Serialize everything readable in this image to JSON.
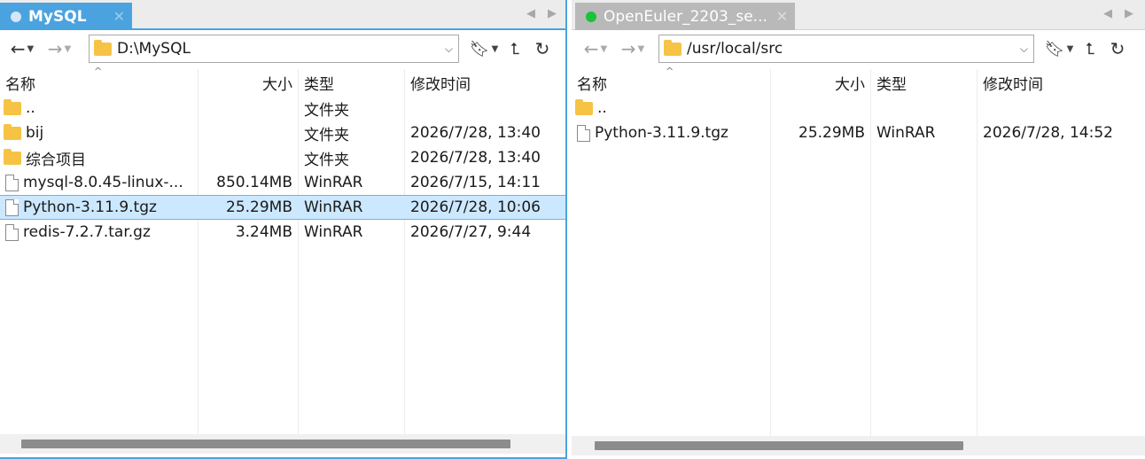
{
  "columns": {
    "name": "名称",
    "size": "大小",
    "type": "类型",
    "modified": "修改时间"
  },
  "left_pane": {
    "tab_title": "MySQL",
    "tab_dot_color": "#d6e6f5",
    "path": "D:\\MySQL",
    "rows": [
      {
        "icon": "folder-icon",
        "name": "..",
        "size": "",
        "type": "文件夹",
        "modified": ""
      },
      {
        "icon": "folder-icon",
        "name": "bij",
        "size": "",
        "type": "文件夹",
        "modified": "2026/7/28, 13:40"
      },
      {
        "icon": "folder-icon",
        "name": "综合项目",
        "size": "",
        "type": "文件夹",
        "modified": "2026/7/28, 13:40"
      },
      {
        "icon": "file-icon",
        "name": "mysql-8.0.45-linux-...",
        "size": "850.14MB",
        "type": "WinRAR",
        "modified": "2026/7/15, 14:11"
      },
      {
        "icon": "file-icon",
        "name": "Python-3.11.9.tgz",
        "size": "25.29MB",
        "type": "WinRAR",
        "modified": "2026/7/28, 10:06",
        "selected": true
      },
      {
        "icon": "file-icon",
        "name": "redis-7.2.7.tar.gz",
        "size": "3.24MB",
        "type": "WinRAR",
        "modified": "2026/7/27, 9:44"
      }
    ]
  },
  "right_pane": {
    "tab_title": "OpenEuler_2203_se...",
    "tab_dot_color": "#19c23a",
    "path": "/usr/local/src",
    "rows": [
      {
        "icon": "folder-icon",
        "name": "..",
        "size": "",
        "type": "",
        "modified": ""
      },
      {
        "icon": "file-icon",
        "name": "Python-3.11.9.tgz",
        "size": "25.29MB",
        "type": "WinRAR",
        "modified": "2026/7/28, 14:52"
      }
    ]
  },
  "accent_color": "#4aa3df",
  "selection_color": "#cce8ff"
}
